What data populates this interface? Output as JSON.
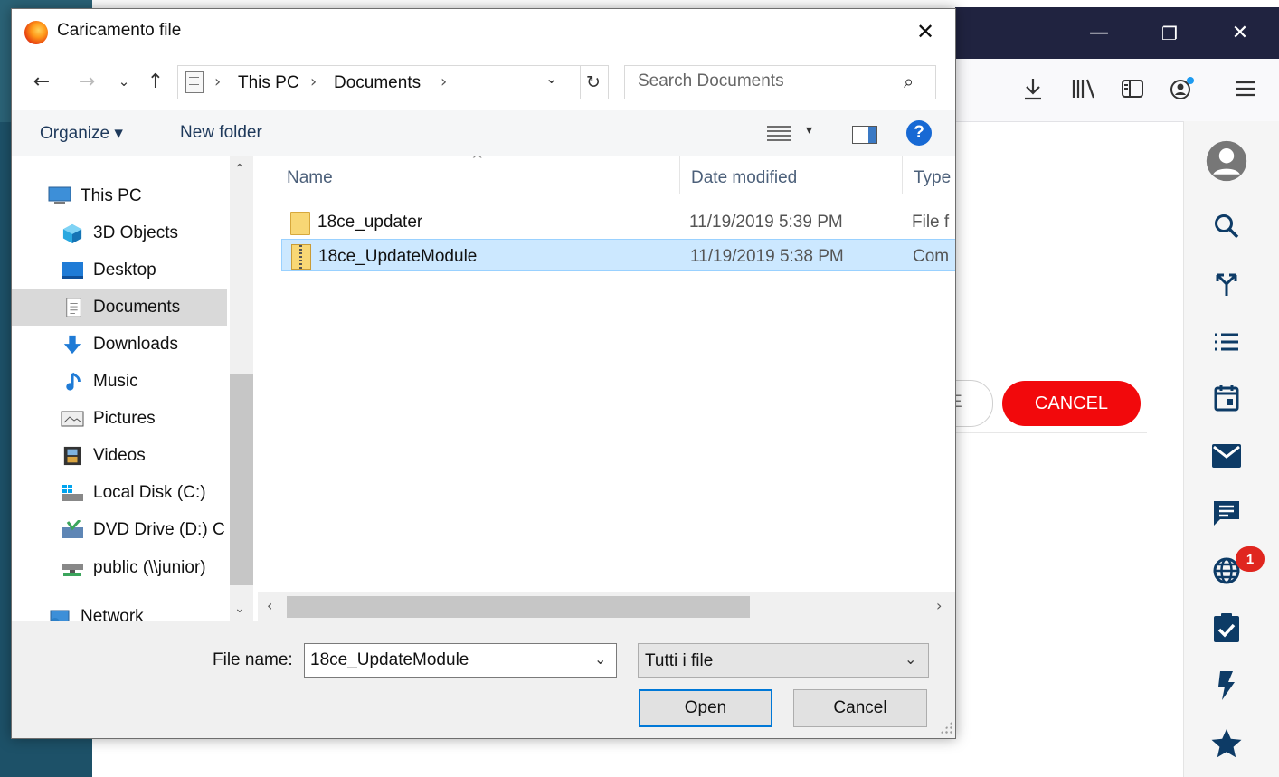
{
  "browser": {
    "window_controls": {
      "minimize": "—",
      "restore": "❐",
      "close": "✕"
    },
    "toolbar_icons": [
      "download-icon",
      "library-icon",
      "reader-view-icon",
      "account-icon",
      "menu-icon"
    ],
    "sidebar_icons": [
      "avatar-icon",
      "search-icon",
      "share-icon",
      "list-icon",
      "calendar-icon",
      "mail-icon",
      "chat-icon",
      "globe-icon",
      "task-icon",
      "flash-icon",
      "star-icon"
    ],
    "notification_badge": "1",
    "cancel_label": "CANCEL",
    "partial_button_label": "E",
    "accent_color": "#f2090c"
  },
  "dialog": {
    "title": "Caricamento file",
    "close_label": "✕",
    "nav": {
      "back": "←",
      "forward": "→",
      "recent": "⌄",
      "up": "↑",
      "refresh": "↻"
    },
    "address": {
      "crumbs": [
        "This PC",
        "Documents"
      ],
      "separator": "›",
      "dropdown": "⌄"
    },
    "search": {
      "placeholder": "Search Documents",
      "icon": "⌕"
    },
    "commands": {
      "organize": "Organize ▾",
      "new_folder": "New folder",
      "view_dropdown": "▾",
      "help": "?"
    },
    "nav_pane": {
      "items": [
        {
          "label": "This PC",
          "icon": "computer-icon"
        },
        {
          "label": "3D Objects",
          "icon": "cube-icon"
        },
        {
          "label": "Desktop",
          "icon": "desktop-icon"
        },
        {
          "label": "Documents",
          "icon": "document-icon",
          "selected": true
        },
        {
          "label": "Downloads",
          "icon": "download-icon"
        },
        {
          "label": "Music",
          "icon": "music-note-icon"
        },
        {
          "label": "Pictures",
          "icon": "picture-icon"
        },
        {
          "label": "Videos",
          "icon": "film-icon"
        },
        {
          "label": "Local Disk (C:)",
          "icon": "drive-icon"
        },
        {
          "label": "DVD Drive (D:) C",
          "icon": "dvd-icon"
        },
        {
          "label": "public (\\\\junior)",
          "icon": "network-drive-icon"
        },
        {
          "label": "Network",
          "icon": "network-icon"
        }
      ],
      "scroll_up": "⌃",
      "scroll_down": "⌄"
    },
    "columns": {
      "name": "Name",
      "date": "Date modified",
      "type": "Type",
      "sort_indicator": "^"
    },
    "files": [
      {
        "name": "18ce_updater",
        "date": "11/19/2019 5:39 PM",
        "type": "File f",
        "kind": "folder"
      },
      {
        "name": "18ce_UpdateModule",
        "date": "11/19/2019 5:38 PM",
        "type": "Com",
        "kind": "zip",
        "selected": true
      }
    ],
    "hscroll": {
      "left": "‹",
      "right": "›"
    },
    "filename": {
      "label": "File name:",
      "value": "18ce_UpdateModule",
      "dropdown": "⌄"
    },
    "filetype": {
      "value": "Tutti i file",
      "dropdown": "⌄"
    },
    "buttons": {
      "open": "Open",
      "cancel": "Cancel"
    },
    "colors": {
      "selection": "#cce8ff",
      "help": "#1769d4",
      "default_button_border": "#0078d7"
    }
  }
}
